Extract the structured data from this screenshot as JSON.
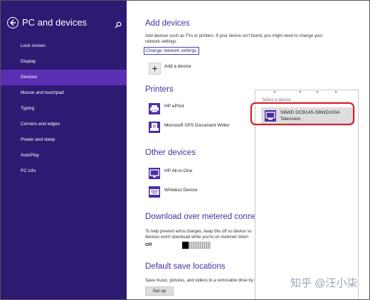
{
  "sidebar": {
    "title": "PC and devices",
    "items": [
      {
        "label": "Lock screen"
      },
      {
        "label": "Display"
      },
      {
        "label": "Devices"
      },
      {
        "label": "Mouse and touchpad"
      },
      {
        "label": "Typing"
      },
      {
        "label": "Corners and edges"
      },
      {
        "label": "Power and sleep"
      },
      {
        "label": "AutoPlay"
      },
      {
        "label": "PC info"
      }
    ],
    "selected": "Devices",
    "bg_color": "#2e1a72",
    "selected_color": "#5a2fb4"
  },
  "main": {
    "add_devices": {
      "heading": "Add devices",
      "desc_line1": "Add devices such as TVs or printers. If your device isn't found, you might need to change your",
      "desc_line2": "network settings.",
      "link": "Change network settings",
      "add_label": "Add a device",
      "add_symbol": "+"
    },
    "printers": {
      "heading": "Printers",
      "items": [
        {
          "label": "HP ePrint",
          "icon": "printer-icon"
        },
        {
          "label": "Microsoft XPS Document Writer",
          "icon": "document-printer-icon"
        }
      ]
    },
    "other_devices": {
      "heading": "Other devices",
      "items": [
        {
          "label": "HP All-in-One",
          "icon": "monitor-icon"
        },
        {
          "label": "Wireless Device",
          "icon": "keyboard-icon"
        }
      ]
    },
    "metered": {
      "heading": "Download over metered conne",
      "desc_line1": "To help prevent extra charges, keep this off so device so",
      "desc_line2": "devices won't download while you're on metered Intern",
      "toggle_label": "Off"
    },
    "default_save": {
      "heading": "Default save locations",
      "desc": "Save music, pictures, and videos to a removable drive by default",
      "button": "Set up"
    }
  },
  "flyout": {
    "title": "Select a device",
    "device_name": "SBWD DCB14S-SBWD100A",
    "device_type": "Television",
    "highlight_color": "#d0202a"
  },
  "watermark": "知乎 @汪小柒",
  "accent_color": "#4b2ea1"
}
